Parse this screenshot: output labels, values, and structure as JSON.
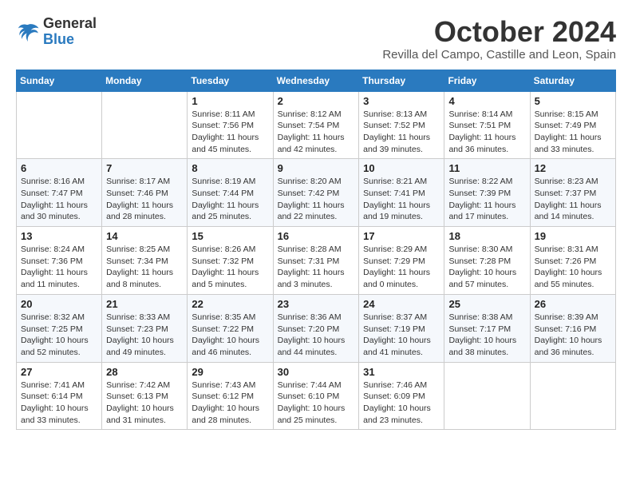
{
  "header": {
    "logo_general": "General",
    "logo_blue": "Blue",
    "month": "October 2024",
    "location": "Revilla del Campo, Castille and Leon, Spain"
  },
  "weekdays": [
    "Sunday",
    "Monday",
    "Tuesday",
    "Wednesday",
    "Thursday",
    "Friday",
    "Saturday"
  ],
  "weeks": [
    [
      {
        "day": "",
        "info": ""
      },
      {
        "day": "",
        "info": ""
      },
      {
        "day": "1",
        "info": "Sunrise: 8:11 AM\nSunset: 7:56 PM\nDaylight: 11 hours and 45 minutes."
      },
      {
        "day": "2",
        "info": "Sunrise: 8:12 AM\nSunset: 7:54 PM\nDaylight: 11 hours and 42 minutes."
      },
      {
        "day": "3",
        "info": "Sunrise: 8:13 AM\nSunset: 7:52 PM\nDaylight: 11 hours and 39 minutes."
      },
      {
        "day": "4",
        "info": "Sunrise: 8:14 AM\nSunset: 7:51 PM\nDaylight: 11 hours and 36 minutes."
      },
      {
        "day": "5",
        "info": "Sunrise: 8:15 AM\nSunset: 7:49 PM\nDaylight: 11 hours and 33 minutes."
      }
    ],
    [
      {
        "day": "6",
        "info": "Sunrise: 8:16 AM\nSunset: 7:47 PM\nDaylight: 11 hours and 30 minutes."
      },
      {
        "day": "7",
        "info": "Sunrise: 8:17 AM\nSunset: 7:46 PM\nDaylight: 11 hours and 28 minutes."
      },
      {
        "day": "8",
        "info": "Sunrise: 8:19 AM\nSunset: 7:44 PM\nDaylight: 11 hours and 25 minutes."
      },
      {
        "day": "9",
        "info": "Sunrise: 8:20 AM\nSunset: 7:42 PM\nDaylight: 11 hours and 22 minutes."
      },
      {
        "day": "10",
        "info": "Sunrise: 8:21 AM\nSunset: 7:41 PM\nDaylight: 11 hours and 19 minutes."
      },
      {
        "day": "11",
        "info": "Sunrise: 8:22 AM\nSunset: 7:39 PM\nDaylight: 11 hours and 17 minutes."
      },
      {
        "day": "12",
        "info": "Sunrise: 8:23 AM\nSunset: 7:37 PM\nDaylight: 11 hours and 14 minutes."
      }
    ],
    [
      {
        "day": "13",
        "info": "Sunrise: 8:24 AM\nSunset: 7:36 PM\nDaylight: 11 hours and 11 minutes."
      },
      {
        "day": "14",
        "info": "Sunrise: 8:25 AM\nSunset: 7:34 PM\nDaylight: 11 hours and 8 minutes."
      },
      {
        "day": "15",
        "info": "Sunrise: 8:26 AM\nSunset: 7:32 PM\nDaylight: 11 hours and 5 minutes."
      },
      {
        "day": "16",
        "info": "Sunrise: 8:28 AM\nSunset: 7:31 PM\nDaylight: 11 hours and 3 minutes."
      },
      {
        "day": "17",
        "info": "Sunrise: 8:29 AM\nSunset: 7:29 PM\nDaylight: 11 hours and 0 minutes."
      },
      {
        "day": "18",
        "info": "Sunrise: 8:30 AM\nSunset: 7:28 PM\nDaylight: 10 hours and 57 minutes."
      },
      {
        "day": "19",
        "info": "Sunrise: 8:31 AM\nSunset: 7:26 PM\nDaylight: 10 hours and 55 minutes."
      }
    ],
    [
      {
        "day": "20",
        "info": "Sunrise: 8:32 AM\nSunset: 7:25 PM\nDaylight: 10 hours and 52 minutes."
      },
      {
        "day": "21",
        "info": "Sunrise: 8:33 AM\nSunset: 7:23 PM\nDaylight: 10 hours and 49 minutes."
      },
      {
        "day": "22",
        "info": "Sunrise: 8:35 AM\nSunset: 7:22 PM\nDaylight: 10 hours and 46 minutes."
      },
      {
        "day": "23",
        "info": "Sunrise: 8:36 AM\nSunset: 7:20 PM\nDaylight: 10 hours and 44 minutes."
      },
      {
        "day": "24",
        "info": "Sunrise: 8:37 AM\nSunset: 7:19 PM\nDaylight: 10 hours and 41 minutes."
      },
      {
        "day": "25",
        "info": "Sunrise: 8:38 AM\nSunset: 7:17 PM\nDaylight: 10 hours and 38 minutes."
      },
      {
        "day": "26",
        "info": "Sunrise: 8:39 AM\nSunset: 7:16 PM\nDaylight: 10 hours and 36 minutes."
      }
    ],
    [
      {
        "day": "27",
        "info": "Sunrise: 7:41 AM\nSunset: 6:14 PM\nDaylight: 10 hours and 33 minutes."
      },
      {
        "day": "28",
        "info": "Sunrise: 7:42 AM\nSunset: 6:13 PM\nDaylight: 10 hours and 31 minutes."
      },
      {
        "day": "29",
        "info": "Sunrise: 7:43 AM\nSunset: 6:12 PM\nDaylight: 10 hours and 28 minutes."
      },
      {
        "day": "30",
        "info": "Sunrise: 7:44 AM\nSunset: 6:10 PM\nDaylight: 10 hours and 25 minutes."
      },
      {
        "day": "31",
        "info": "Sunrise: 7:46 AM\nSunset: 6:09 PM\nDaylight: 10 hours and 23 minutes."
      },
      {
        "day": "",
        "info": ""
      },
      {
        "day": "",
        "info": ""
      }
    ]
  ]
}
